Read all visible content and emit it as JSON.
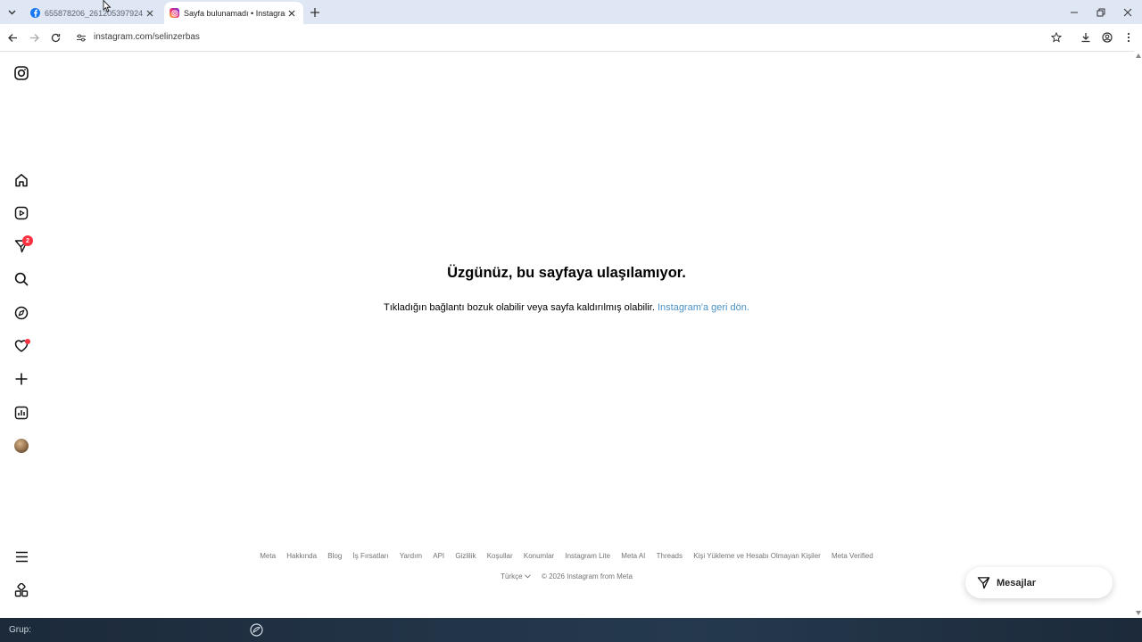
{
  "browser": {
    "tabs": [
      {
        "title": "655878206_261205397924120...",
        "favicon": "facebook-icon",
        "active": false
      },
      {
        "title": "Sayfa bulunamadı • Instagram",
        "favicon": "instagram-icon",
        "active": true
      }
    ],
    "url": "instagram.com/selinzerbas"
  },
  "sidebar": {
    "notifications_badge": "2"
  },
  "main": {
    "heading": "Üzgünüz, bu sayfaya ulaşılamıyor.",
    "message": "Tıkladığın bağlantı bozuk olabilir veya sayfa kaldırılmış olabilir.",
    "link": "Instagram'a geri dön."
  },
  "footer": {
    "links": [
      "Meta",
      "Hakkında",
      "Blog",
      "İş Fırsatları",
      "Yardım",
      "API",
      "Gizlilik",
      "Koşullar",
      "Konumlar",
      "Instagram Lite",
      "Meta AI",
      "Threads",
      "Kişi Yükleme ve Hesabı Olmayan Kişiler",
      "Meta Verified"
    ],
    "language": "Türkçe",
    "copyright": "© 2026 Instagram from Meta"
  },
  "messages_button": {
    "label": "Mesajlar"
  },
  "taskbar": {
    "group_label": "Grup:"
  },
  "colors": {
    "link": "#4a91c7",
    "badge": "#ff3040",
    "tabbar": "#dfe6f4"
  }
}
